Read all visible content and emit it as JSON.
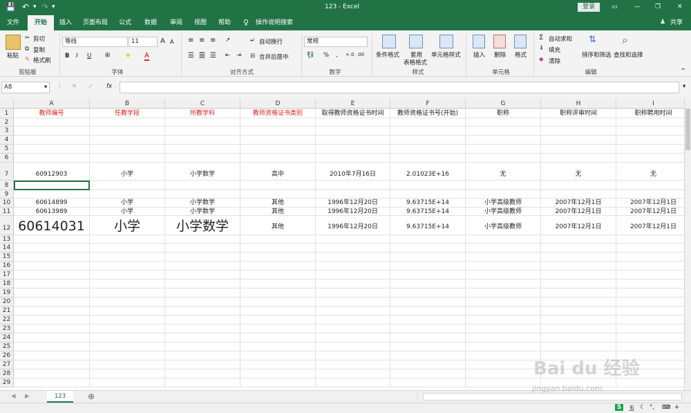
{
  "titlebar": {
    "file_title": "123 - Excel",
    "login": "登录"
  },
  "menu": {
    "tabs": [
      "文件",
      "开始",
      "插入",
      "页面布局",
      "公式",
      "数据",
      "审阅",
      "视图",
      "帮助"
    ],
    "tell_me": "操作说明搜索",
    "share": "共享"
  },
  "ribbon": {
    "clipboard": {
      "paste": "粘贴",
      "cut": "剪切",
      "copy": "复制",
      "format_painter": "格式刷",
      "label": "剪贴板"
    },
    "font": {
      "name": "等线",
      "size": "11",
      "bold": "B",
      "italic": "I",
      "underline": "U",
      "grow": "A",
      "shrink": "A",
      "font_color": "A",
      "label": "字体"
    },
    "alignment": {
      "wrap": "自动换行",
      "merge": "合并后居中",
      "label": "对齐方式"
    },
    "number": {
      "format": "常规",
      "percent": "%",
      "comma": ",",
      "label": "数字"
    },
    "styles": {
      "conditional": "条件格式",
      "table_1": "套用",
      "table_2": "表格格式",
      "cell_styles": "单元格样式",
      "label": "样式"
    },
    "cells": {
      "insert": "插入",
      "delete": "删除",
      "format": "格式",
      "label": "单元格"
    },
    "editing": {
      "autosum": "自动求和",
      "fill": "填充",
      "clear": "清除",
      "sort": "排序和筛选",
      "find": "查找和选择",
      "label": "编辑"
    }
  },
  "formula": {
    "name_box": "A8",
    "fx": "fx",
    "value": ""
  },
  "sheet": {
    "columns": [
      "A",
      "B",
      "C",
      "D",
      "E",
      "F",
      "G",
      "H",
      "I"
    ],
    "rows": [
      "1",
      "2",
      "3",
      "4",
      "5",
      "6",
      "7",
      "8",
      "9",
      "10",
      "11",
      "12",
      "13",
      "14",
      "15",
      "16",
      "17",
      "18",
      "19",
      "20",
      "21",
      "22",
      "23",
      "24",
      "25",
      "26",
      "27",
      "28",
      "29"
    ],
    "r1": [
      "教师编号",
      "任教学段",
      "所教学科",
      "教师资格证书类别",
      "取得教师资格证书时间",
      "教师资格证书号(开始)",
      "职称",
      "职称评审时间",
      "职称聘用时间"
    ],
    "r7": [
      "60912903",
      "小学",
      "小学数学",
      "高中",
      "2010年7月16日",
      "2.01023E+16",
      "无",
      "无",
      "无"
    ],
    "r10": [
      "60614899",
      "小学",
      "小学数学",
      "其他",
      "1996年12月20日",
      "9.63715E+14",
      "小学高级教师",
      "2007年12月1日",
      "2007年12月1日"
    ],
    "r11": [
      "60613989",
      "小学",
      "小学数学",
      "其他",
      "1996年12月20日",
      "9.63715E+14",
      "小学高级教师",
      "2007年12月1日",
      "2007年12月1日"
    ],
    "r12": [
      "60614031",
      "小学",
      "小学数学",
      "其他",
      "1996年12月20日",
      "9.63715E+14",
      "小学高级教师",
      "2007年12月1日",
      "2007年12月1日"
    ]
  },
  "sheetbar": {
    "tab": "123",
    "add": "⊕"
  },
  "watermark": {
    "brand": "Bai du 经验",
    "url": "jingyan.baidu.com"
  },
  "status": {
    "ime": "五"
  },
  "colors": {
    "excel_green": "#217346",
    "header_red": "#e02020"
  }
}
